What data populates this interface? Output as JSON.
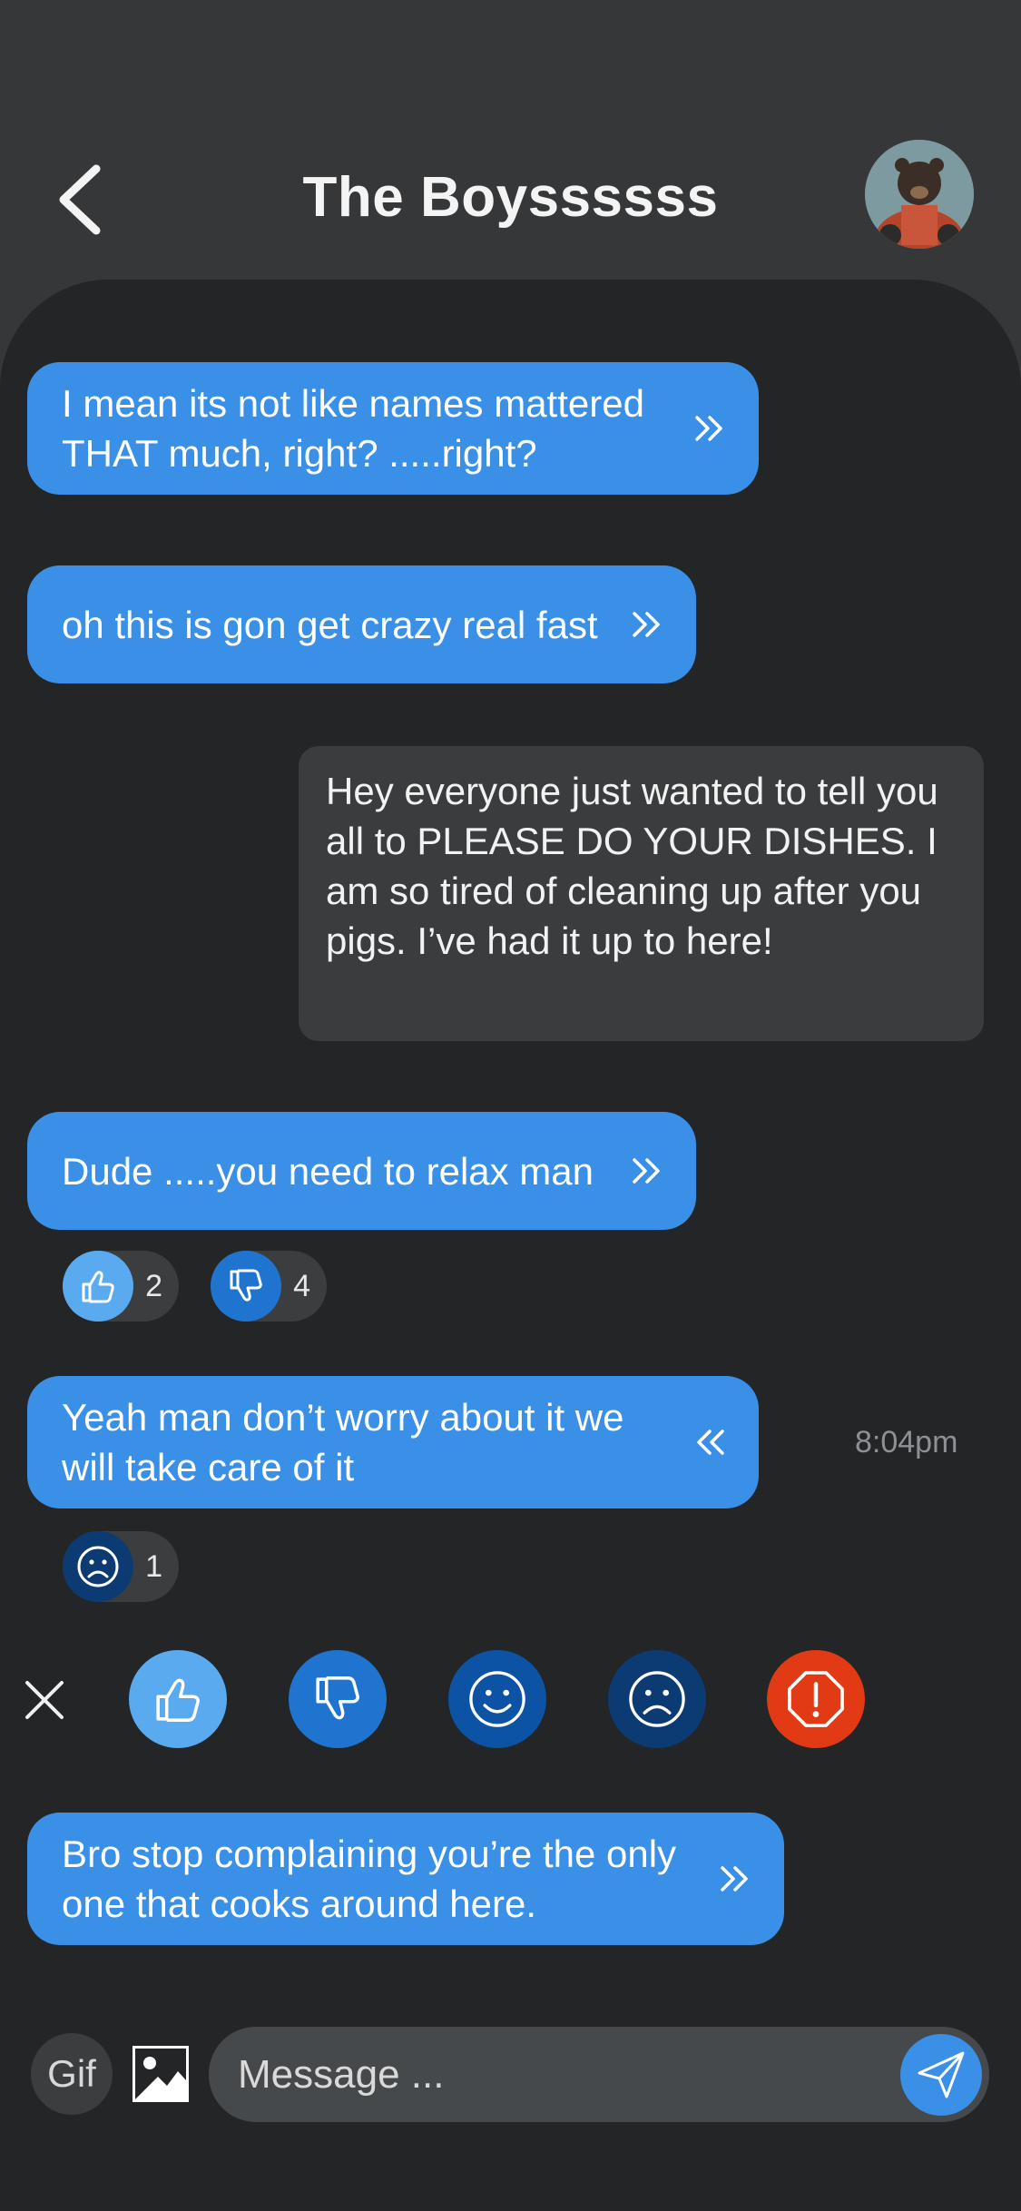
{
  "header": {
    "title": "The Boyssssss"
  },
  "messages": [
    {
      "text": "I mean its not like names mattered THAT much, right? .....right?",
      "arrow": "forward"
    },
    {
      "text": "oh this is gon get crazy real fast",
      "arrow": "forward"
    },
    {
      "text": "Hey everyone just wanted to tell you all to PLEASE DO YOUR DISHES. I am so tired of cleaning up after you pigs. I’ve had it up to here!"
    },
    {
      "text": "Dude .....you need to relax man",
      "arrow": "forward",
      "reactions": [
        {
          "icon": "thumbs-up-icon",
          "count": "2"
        },
        {
          "icon": "thumbs-down-icon",
          "count": "4"
        }
      ]
    },
    {
      "text": "Yeah man don’t worry about it we will take care of it",
      "arrow": "back",
      "time": "8:04pm",
      "reactions": [
        {
          "icon": "sad-face-icon",
          "count": "1"
        }
      ]
    },
    {
      "text": "Bro stop complaining you’re the only one that cooks around here.",
      "arrow": "forward"
    }
  ],
  "reaction_picker": {
    "options": [
      "thumbs-up-icon",
      "thumbs-down-icon",
      "smile-face-icon",
      "sad-face-icon",
      "alert-icon"
    ]
  },
  "composer": {
    "gif_label": "Gif",
    "placeholder": "Message ..."
  },
  "colors": {
    "background": "#232527",
    "header": "#353739",
    "bubble_in": "#3a8fe6",
    "bubble_out": "#3a3c3e",
    "like": "#5aaaf0",
    "dislike": "#1f74cf",
    "smile": "#0c52a5",
    "sad": "#0c3b73",
    "alert": "#e23a14"
  }
}
